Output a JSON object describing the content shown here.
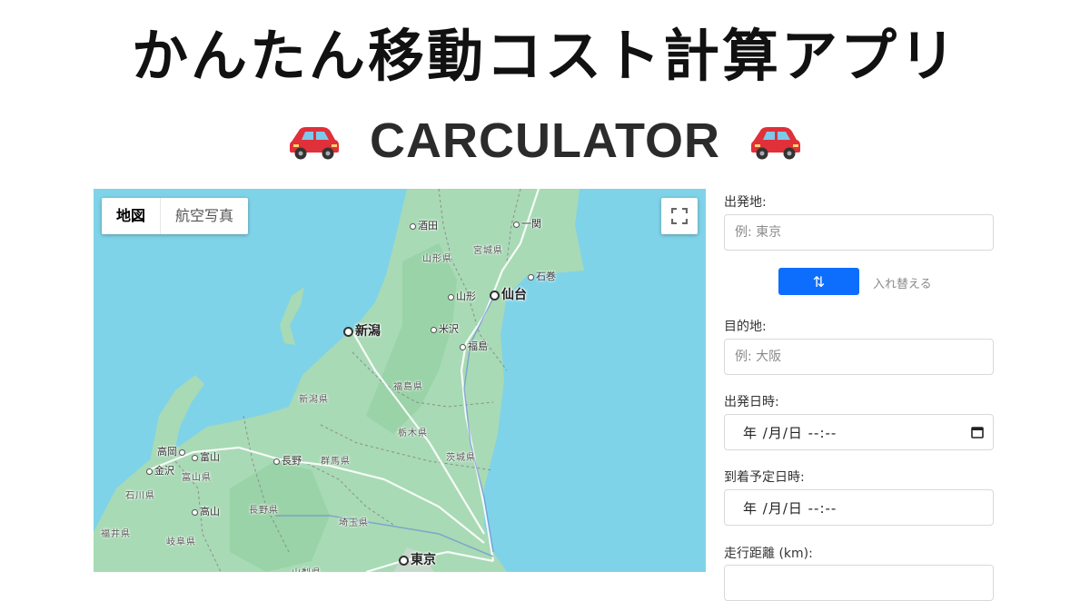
{
  "header": {
    "title": "かんたん移動コスト計算アプリ",
    "subtitle": "CARCULATOR"
  },
  "map": {
    "type_tabs": [
      {
        "label": "地図",
        "active": true
      },
      {
        "label": "航空写真",
        "active": false
      }
    ],
    "labels": {
      "sakata": "酒田",
      "ichinoseki": "一関",
      "yamagata_pref": "山形県",
      "miyagi_pref": "宮城県",
      "ishinomaki": "石巻",
      "yamagata": "山形",
      "sendai": "仙台",
      "niigata": "新潟",
      "yonezawa": "米沢",
      "fukushima": "福島",
      "niigata_pref": "新潟県",
      "fukushima_pref": "福島県",
      "tochigi_pref": "栃木県",
      "takaoka": "高岡",
      "toyama": "富山",
      "nagano": "長野",
      "gunma_pref": "群馬県",
      "ibaraki_pref": "茨城県",
      "kanazawa": "金沢",
      "toyama_pref": "富山県",
      "ishikawa_pref": "石川県",
      "takayama": "高山",
      "nagano_pref": "長野県",
      "saitama_pref": "埼玉県",
      "fukui_pref": "福井県",
      "gifu_pref": "岐阜県",
      "tokyo": "東京",
      "yamanashi_pref": "山梨県"
    }
  },
  "form": {
    "origin_label": "出発地:",
    "origin_placeholder": "例: 東京",
    "swap_label": "入れ替える",
    "destination_label": "目的地:",
    "destination_placeholder": "例: 大阪",
    "depart_label": "出発日時:",
    "depart_value": "年 /月/日 --:--",
    "arrive_label": "到着予定日時:",
    "arrive_value": "年 /月/日 --:--",
    "distance_label": "走行距離 (km):"
  },
  "colors": {
    "accent": "#0d6efd",
    "sea": "#7fd3e8",
    "land": "#a8dab5"
  }
}
